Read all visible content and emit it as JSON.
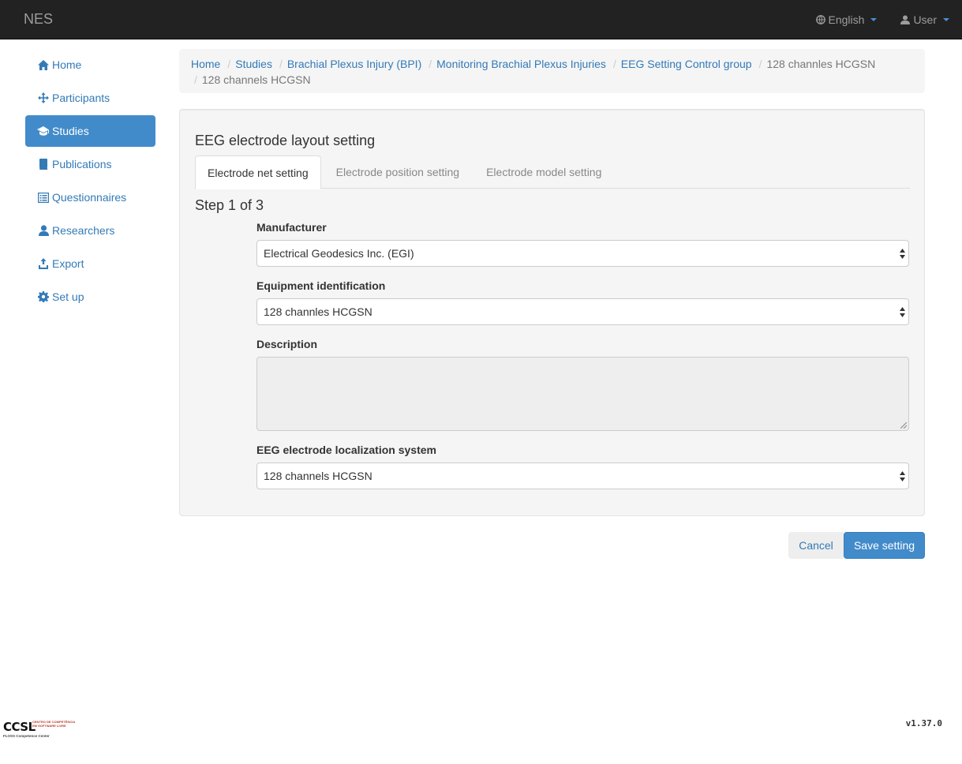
{
  "navbar": {
    "brand": "NES",
    "language": "English",
    "user": "User",
    "accent": "#428bca"
  },
  "sidebar": {
    "items": [
      {
        "label": "Home",
        "icon": "home-icon"
      },
      {
        "label": "Participants",
        "icon": "move-icon"
      },
      {
        "label": "Studies",
        "icon": "graduation-cap-icon",
        "active": true
      },
      {
        "label": "Publications",
        "icon": "book-icon"
      },
      {
        "label": "Questionnaires",
        "icon": "list-alt-icon"
      },
      {
        "label": "Researchers",
        "icon": "user-icon"
      },
      {
        "label": "Export",
        "icon": "export-icon"
      },
      {
        "label": "Set up",
        "icon": "cog-icon"
      }
    ]
  },
  "breadcrumb": {
    "links": [
      "Home",
      "Studies",
      "Brachial Plexus Injury (BPI)",
      "Monitoring Brachial Plexus Injuries",
      "EEG Setting Control group"
    ],
    "inactive1": "128 channles HCGSN",
    "current": "128 channels HCGSN"
  },
  "panel": {
    "title": "EEG electrode layout setting",
    "tabs": [
      "Electrode net setting",
      "Electrode position setting",
      "Electrode model setting"
    ],
    "step": "Step 1 of 3",
    "manufacturer": {
      "label": "Manufacturer",
      "value": "Electrical Geodesics Inc. (EGI)"
    },
    "equipment": {
      "label": "Equipment identification",
      "value": "128 channles HCGSN"
    },
    "description": {
      "label": "Description",
      "value": ""
    },
    "localization": {
      "label": "EEG electrode localization system",
      "value": "128 channels HCGSN"
    }
  },
  "actions": {
    "cancel": "Cancel",
    "save": "Save setting"
  },
  "footer": {
    "logo_main": "CCSL",
    "logo_side": "CENTRO DE COMPETÊNCIA EM SOFTWARE LIVRE",
    "logo_foot": "FLOSS Competence Center",
    "version": "v1.37.0"
  }
}
